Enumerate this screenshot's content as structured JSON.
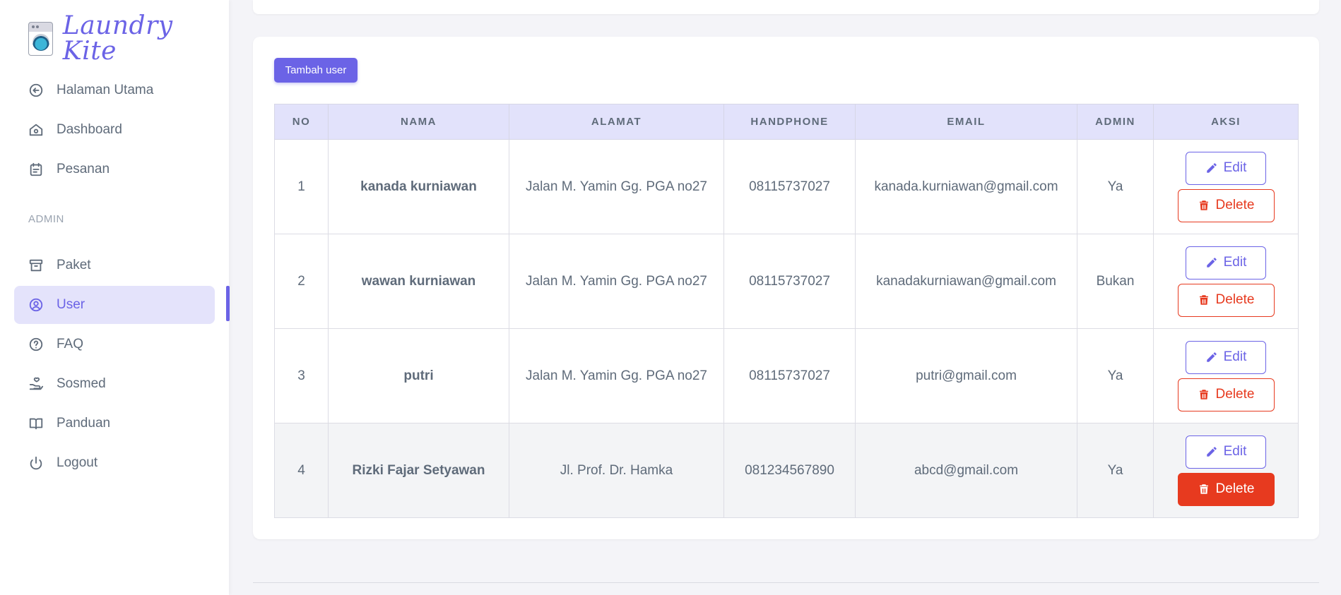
{
  "brand": {
    "name": "Laundry Kite"
  },
  "sidebar": {
    "items": [
      {
        "label": "Halaman Utama",
        "icon": "arrow-left-circle-icon"
      },
      {
        "label": "Dashboard",
        "icon": "home-icon"
      },
      {
        "label": "Pesanan",
        "icon": "calendar-icon"
      }
    ],
    "section_label": "ADMIN",
    "admin_items": [
      {
        "label": "Paket",
        "icon": "archive-icon"
      },
      {
        "label": "User",
        "icon": "user-circle-icon",
        "active": true
      },
      {
        "label": "FAQ",
        "icon": "help-circle-icon"
      },
      {
        "label": "Sosmed",
        "icon": "hand-heart-icon"
      },
      {
        "label": "Panduan",
        "icon": "book-icon"
      },
      {
        "label": "Logout",
        "icon": "power-icon"
      }
    ]
  },
  "main": {
    "add_button": "Tambah user",
    "columns": [
      "NO",
      "NAMA",
      "ALAMAT",
      "HANDPHONE",
      "EMAIL",
      "ADMIN",
      "AKSI"
    ],
    "edit_label": "Edit",
    "delete_label": "Delete",
    "rows": [
      {
        "no": "1",
        "nama": "kanada kurniawan",
        "alamat": "Jalan M. Yamin Gg. PGA no27",
        "handphone": "08115737027",
        "email": "kanada.kurniawan@gmail.com",
        "admin": "Ya"
      },
      {
        "no": "2",
        "nama": "wawan kurniawan",
        "alamat": "Jalan M. Yamin Gg. PGA no27",
        "handphone": "08115737027",
        "email": "kanadakurniawan@gmail.com",
        "admin": "Bukan"
      },
      {
        "no": "3",
        "nama": "putri",
        "alamat": "Jalan M. Yamin Gg. PGA no27",
        "handphone": "08115737027",
        "email": "putri@gmail.com",
        "admin": "Ya"
      },
      {
        "no": "4",
        "nama": "Rizki Fajar Setyawan",
        "alamat": "Jl. Prof. Dr. Hamka",
        "handphone": "081234567890",
        "email": "abcd@gmail.com",
        "admin": "Ya"
      }
    ]
  },
  "colors": {
    "accent": "#6b63e6",
    "danger": "#e73a1f",
    "header_bg": "#e2e2fb"
  }
}
